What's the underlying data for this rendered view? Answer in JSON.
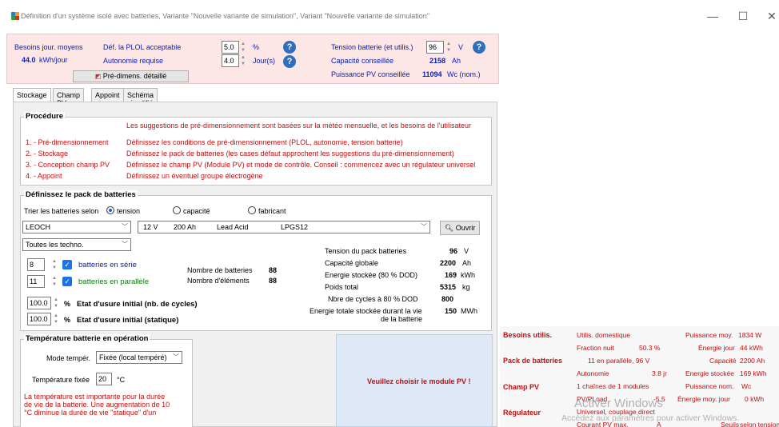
{
  "window": {
    "title": "Définition d'un système isolé avec batteries, Variante  \"Nouvelle variante de simulation\", Variant  \"Nouvelle variante de simulation\"",
    "minimize": "—",
    "maximize": "☐",
    "close": "✕"
  },
  "header": {
    "daily_needs_label": "Besoins jour. moyens",
    "daily_needs_value": "44.0",
    "daily_needs_unit": "kWh/jour",
    "plol_label": "Déf. la PLOL acceptable",
    "plol_value": "5.0",
    "plol_unit": "%",
    "autonomy_label": "Autonomie requise",
    "autonomy_value": "4.0",
    "autonomy_unit": "Jour(s)",
    "predim_button": "Pré-dimens. détaillé",
    "voltage_label": "Tension batterie (et utilis.)",
    "voltage_value": "96",
    "voltage_unit": "V",
    "capacity_label": "Capacité conseillée",
    "capacity_value": "2158",
    "capacity_unit": "Ah",
    "pv_power_label": "Puissance PV conseillée",
    "pv_power_value": "11094",
    "pv_power_unit": "Wc (nom.)"
  },
  "tabs": [
    "Stockage",
    "Champ PV",
    "Appoint",
    "Schéma simplifié"
  ],
  "procedure": {
    "title": "Procédure",
    "intro": "Les suggestions de pré-dimensionnement sont basées sur la météo mensuelle, et les besoins de l'utilisateur",
    "steps": [
      {
        "step": "1. - Pré-dimensionnement",
        "desc": "Définissez les conditions de pré-dimensionnement (PLOL, autonomie, tension batterie)"
      },
      {
        "step": "2. - Stockage",
        "desc": "Définissez le pack de batteries (les cases défaut approchent les suggestions du pré-dimensionnement)"
      },
      {
        "step": "3. - Conception champ PV",
        "desc": "Définissez le champ PV (Module PV) et mode de contrôle. Conseil : commencez avec un régulateur universel"
      },
      {
        "step": "4. - Appoint",
        "desc": "Définissez un éventuel groupe électrogène"
      }
    ]
  },
  "battery": {
    "title": "Définissez le pack de batteries",
    "sort_label": "Trier les batteries selon",
    "sort_options": [
      "tension",
      "capacité",
      "fabricant"
    ],
    "manufacturer": "LEOCH",
    "model": {
      "voltage": "12 V",
      "capacity": "200 Ah",
      "tech": "Lead  Acid",
      "name": "LPGS12"
    },
    "open_button": "Ouvrir",
    "tech_filter": "Toutes les techno.",
    "series_value": "8",
    "series_label": "batteries en série",
    "parallel_value": "11",
    "parallel_label": "batteries en parallèle",
    "nb_batteries_label": "Nombre de batteries",
    "nb_batteries_value": "88",
    "nb_elements_label": "Nombre d'éléments",
    "nb_elements_value": "88",
    "wear_cycles_value": "100.0",
    "wear_cycles_unit": "%",
    "wear_cycles_label": "Etat d'usure initial (nb. de cycles)",
    "wear_static_value": "100.0",
    "wear_static_unit": "%",
    "wear_static_label": "Etat d'usure initial (statique)",
    "stats": [
      {
        "label": "Tension du pack batteries",
        "value": "96",
        "unit": "V"
      },
      {
        "label": "Capacité globale",
        "value": "2200",
        "unit": "Ah"
      },
      {
        "label": "Energie stockée (80 % DOD)",
        "value": "169",
        "unit": "kWh"
      },
      {
        "label": "Poids total",
        "value": "5315",
        "unit": "kg"
      },
      {
        "label": "Nbre de cycles à 80 % DOD",
        "value": "800",
        "unit": ""
      }
    ],
    "lifetime_label_1": "Energie totale stockée durant la vie",
    "lifetime_label_2": "de la batterie",
    "lifetime_value": "150",
    "lifetime_unit": "MWh"
  },
  "temperature": {
    "title": "Température batterie en opération",
    "mode_label": "Mode tempér.",
    "mode_value": "Fixée (local tempéré)",
    "fixed_label": "Température fixée",
    "fixed_value": "20",
    "fixed_unit": "°C",
    "note_1": "La température est importante pour la durée",
    "note_2": "de vie de la batterie. Une augmentation de 10",
    "note_3": "°C diminue la durée de vie \"statique\" d'un"
  },
  "pv_warning": "Veuillez choisir le module PV !",
  "summary": {
    "needs_title": "Besoins utilis.",
    "needs_type": "Utilis. domestique",
    "avg_power_label": "Puissance moy.",
    "avg_power_value": "1834 W",
    "night_fraction_label": "Fraction nuit",
    "night_fraction_value": "50.3 %",
    "day_energy_label": "Énergie jour",
    "day_energy_value": "44 kWh",
    "pack_title": "Pack de batteries",
    "pack_config": "11 en parallèle, 96 V",
    "capacity_label": "Capacité",
    "capacity_value": "2200 Ah",
    "autonomy_label": "Autonomie",
    "autonomy_value": "3.8 jr",
    "stored_label": "Energie stockée",
    "stored_value": "169 kWh",
    "pv_title": "Champ PV",
    "pv_config": "1 chaînes de 1 modules",
    "nom_power_label": "Puissance nom.",
    "nom_power_value": "Wc",
    "pvpload_label": "PV/PLoad",
    "pvpload_value": "-5.5",
    "energy_day_label": "Énergie moy. jour",
    "energy_day_value": "0 kWh",
    "reg_title": "Régulateur",
    "reg_value": "Universel, couplage direct",
    "max_current_label": "Courant PV max.",
    "max_current_value": "A",
    "thresholds_label": "Seuils",
    "thresholds_value": "selon tension"
  },
  "watermark": {
    "line1": "Activer Windows",
    "line2": "Accédez aux paramètres pour activer Windows."
  }
}
